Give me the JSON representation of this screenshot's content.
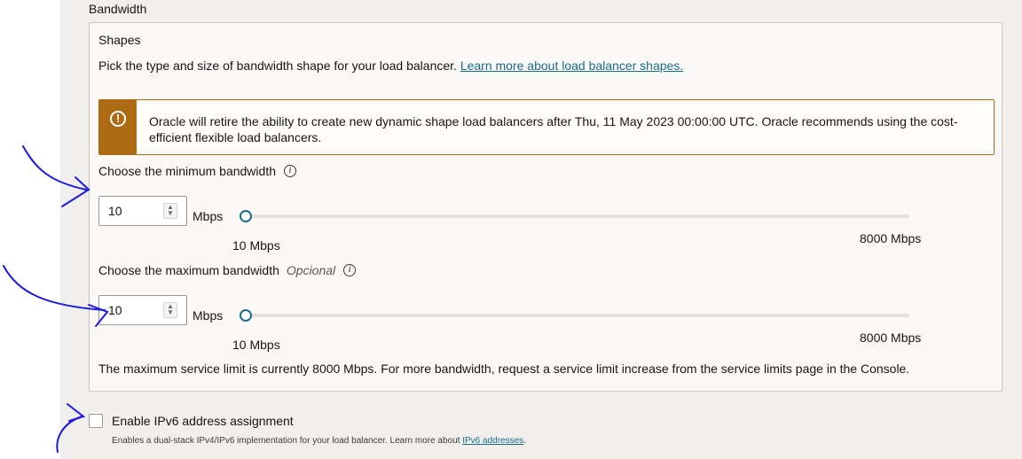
{
  "bandwidth": {
    "section_title": "Bandwidth",
    "shapes": {
      "title": "Shapes",
      "description": "Pick the type and size of bandwidth shape for your load balancer.",
      "link_text": "Learn more about load balancer shapes."
    },
    "warning": {
      "icon": "exclamation-circle-icon",
      "text": "Oracle will retire the ability to create new dynamic shape load balancers after Thu, 11 May 2023 00:00:00 UTC. Oracle recommends using the cost-efficient flexible load balancers.",
      "color": "#ad6a12"
    },
    "minimum": {
      "label": "Choose the minimum bandwidth",
      "value": "10",
      "unit": "Mbps",
      "slider_min_label": "10 Mbps",
      "slider_max_label": "8000 Mbps",
      "slider_fraction": 0
    },
    "maximum": {
      "label": "Choose the maximum bandwidth",
      "optional": "Opcional",
      "value": "10",
      "unit": "Mbps",
      "slider_min_label": "10 Mbps",
      "slider_max_label": "8000 Mbps",
      "slider_fraction": 0
    },
    "limit_note": "The maximum service limit is currently 8000 Mbps. For more bandwidth, request a service limit increase from the service limits page in the Console."
  },
  "ipv6": {
    "label": "Enable IPv6 address assignment",
    "checked": false,
    "help_text": "Enables a dual-stack IPv4/IPv6 implementation for your load balancer. Learn more about ",
    "help_link": "IPv6 addresses",
    "help_suffix": "."
  },
  "colors": {
    "accent": "#1b6c87",
    "annotation": "#1a1adb"
  }
}
